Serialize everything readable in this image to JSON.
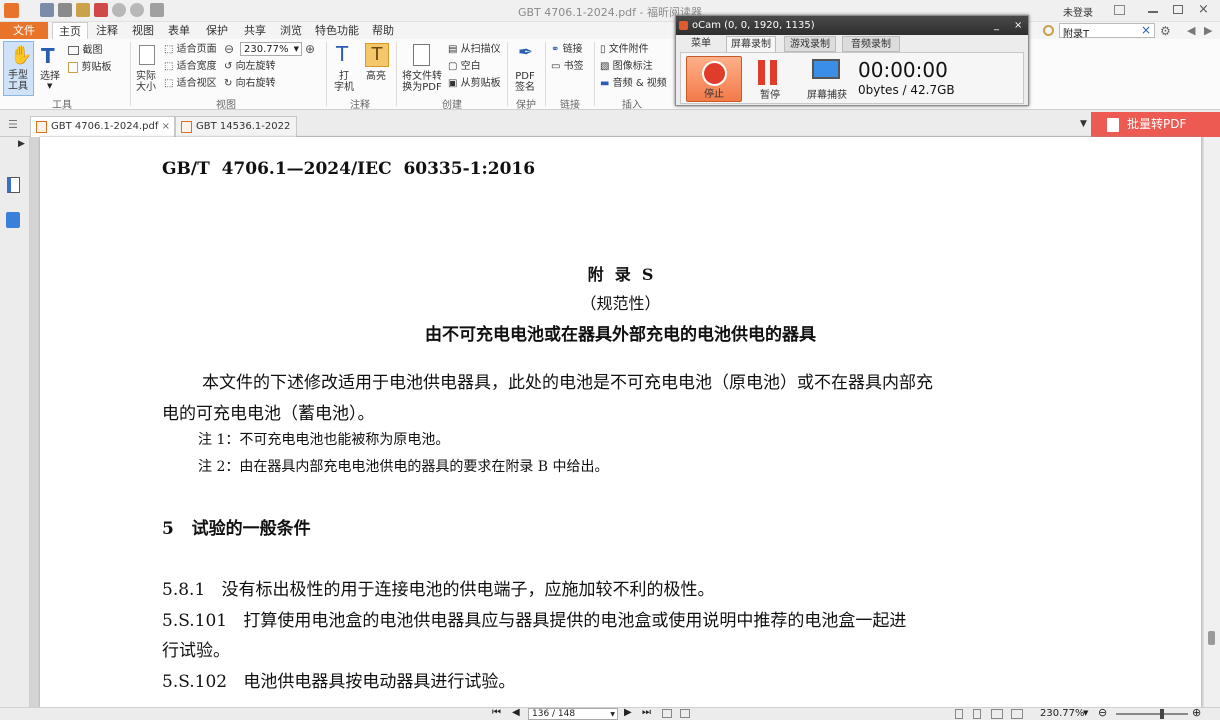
{
  "window": {
    "title": "GBT 4706.1-2024.pdf - 福昕阅读器",
    "login": "未登录",
    "search_value": "附录T"
  },
  "menu": [
    "文件",
    "主页",
    "注释",
    "视图",
    "表单",
    "保护",
    "共享",
    "浏览",
    "特色功能",
    "帮助"
  ],
  "ribbon": {
    "hand_tool": "手型\n工具",
    "select": "选择",
    "screenshot": "截图",
    "clipboard": "剪贴板",
    "actual_size": "实际\n大小",
    "fit_page": "适合页面",
    "fit_width": "适合宽度",
    "fit_visible": "适合视区",
    "zoom": "230.77%",
    "rotate_left": "向左旋转",
    "rotate_right": "向右旋转",
    "typewriter": "打\n字机",
    "highlight": "高亮",
    "convert_pdf": "将文件转\n换为PDF",
    "from_scanner": "从扫描仪",
    "blank": "空白",
    "from_clipboard": "从剪贴板",
    "pdf_sign": "PDF\n签名",
    "link": "链接",
    "bookmark": "书签",
    "file_attach": "文件附件",
    "image_annot": "图像标注",
    "audio_video": "音频 & 视频",
    "groups": {
      "tools": "工具",
      "view": "视图",
      "annot": "注释",
      "create": "创建",
      "protect": "保护",
      "links": "链接",
      "insert": "插入"
    }
  },
  "tabs": [
    {
      "label": "GBT 4706.1-2024.pdf"
    },
    {
      "label": "GBT 14536.1-2022 ..."
    }
  ],
  "upgrade_button": "批量转PDF",
  "ocam": {
    "title": "oCam (0, 0, 1920, 1135)",
    "tabs": [
      "菜单",
      "屏幕录制",
      "游戏录制",
      "音频录制"
    ],
    "stop": "停止",
    "pause": "暂停",
    "capture": "屏幕捕获",
    "timer": "00:00:00",
    "size": "0bytes / 42.7GB"
  },
  "page": {
    "header": "GB/T  4706.1—2024/IEC  60335-1:2016",
    "annex_title": "附  录  S",
    "annex_type": "（规范性）",
    "annex_subtitle": "由不可充电电池或在器具外部充电的电池供电的器具",
    "para1_line1": "本文件的下述修改适用于电池供电器具，此处的电池是不可充电电池（原电池）或不在器具内部充",
    "para1_line2": "电的可充电电池（蓄电池）。",
    "note1": "注 1：不可充电电池也能被称为原电池。",
    "note2": "注 2：由在器具内部充电电池供电的器具的要求在附录 B 中给出。",
    "sec5": "5   试验的一般条件",
    "s581": "5.8.1   没有标出极性的用于连接电池的供电端子，应施加较不利的极性。",
    "s5101_line1": "5.S.101   打算使用电池盒的电池供电器具应与器具提供的电池盒或使用说明中推荐的电池盒一起进",
    "s5101_line2": "行试验。",
    "s5102": "5.S.102   电池供电器具按电动器具进行试验。"
  },
  "status": {
    "page": "136 / 148",
    "zoom": "230.77%"
  }
}
